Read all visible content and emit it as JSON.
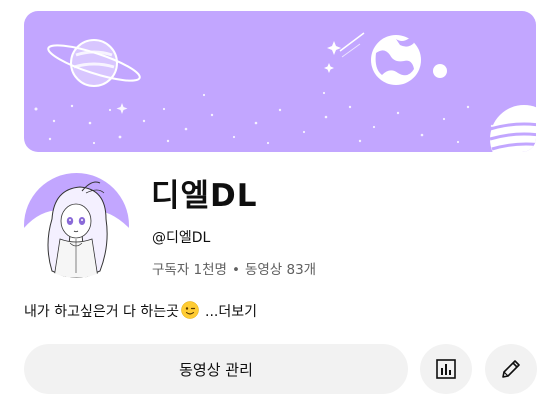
{
  "channel": {
    "name": "디엘DL",
    "handle": "@디엘DL",
    "subscribers": "구독자 1천명",
    "separator": "•",
    "videos": "동영상 83개"
  },
  "description": {
    "text": "내가 하고싶은거 다 하는곳",
    "emoji": "winking-face",
    "more_label": "...더보기"
  },
  "actions": {
    "manage_videos_label": "동영상 관리",
    "analytics_icon": "bar-chart-icon",
    "edit_icon": "pencil-icon"
  },
  "colors": {
    "banner": "#c2a6ff",
    "button_bg": "#f2f2f2",
    "secondary_text": "#606060"
  }
}
